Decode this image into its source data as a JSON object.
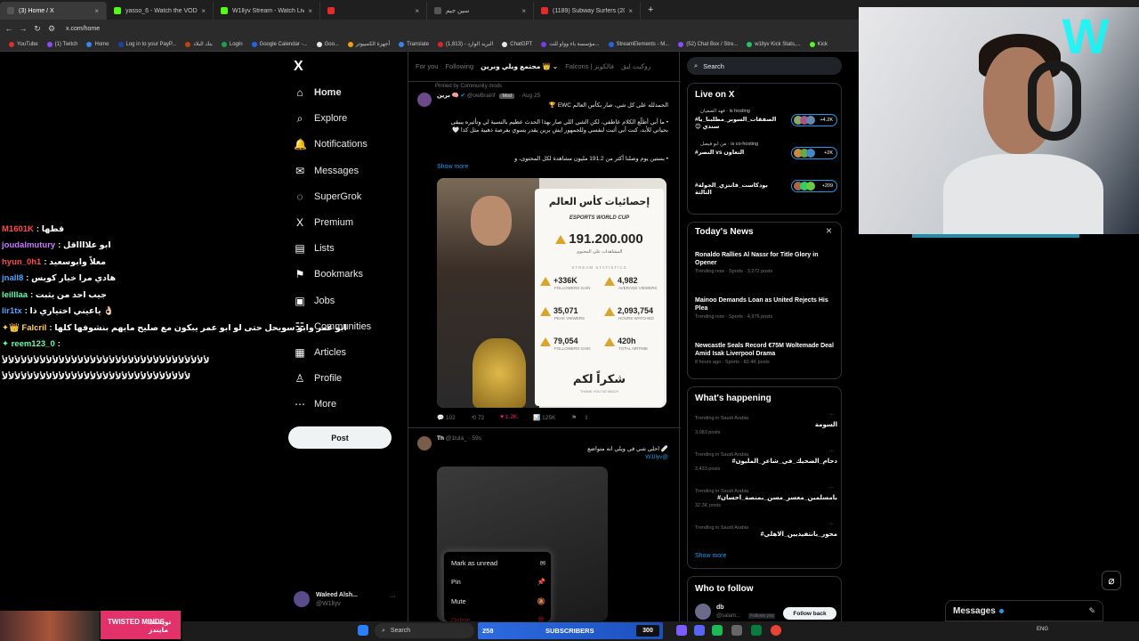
{
  "browser": {
    "tabs": [
      {
        "label": "(3) Home / X",
        "color": "#555555",
        "active": true
      },
      {
        "label": "yasso_6 - Watch the VOD on Kick",
        "color": "#53fc18"
      },
      {
        "label": "W1llyv Stream - Watch Live on",
        "color": "#53fc18"
      },
      {
        "label": "",
        "color": "#e22c2c"
      },
      {
        "label": "سين جيم",
        "color": "#555555"
      },
      {
        "label": "(1189) Subway Surfers (2023)",
        "color": "#e22c2c"
      }
    ],
    "new_tab": "+",
    "url": "x.com/home",
    "bookmarks": [
      {
        "label": "YouTube",
        "color": "#e22c2c"
      },
      {
        "label": "(1) Twitch",
        "color": "#9146ff"
      },
      {
        "label": "Home",
        "color": "#3b82f6"
      },
      {
        "label": "Log in to your PayP...",
        "color": "#1e40af"
      },
      {
        "label": "بنك البلاد",
        "color": "#c2410c"
      },
      {
        "label": "Login",
        "color": "#16a34a"
      },
      {
        "label": "Google Calendar -...",
        "color": "#2563eb"
      },
      {
        "label": "Goo...",
        "color": "#e5e7eb"
      },
      {
        "label": "أجهزة الكمبيوتر",
        "color": "#f59e0b"
      },
      {
        "label": "Translate",
        "color": "#3b82f6"
      },
      {
        "label": "البريد الوارد - (1,813)",
        "color": "#dc2626"
      },
      {
        "label": "ChatGPT",
        "color": "#e5e7eb"
      },
      {
        "label": "مؤسسة باء وواو للت...",
        "color": "#7c3aed"
      },
      {
        "label": "StreamElements - M...",
        "color": "#2563eb"
      },
      {
        "label": "(52) Chat Box / Stre...",
        "color": "#9146ff"
      },
      {
        "label": "w1llyv Kick Stats,...",
        "color": "#22c55e"
      },
      {
        "label": "Kick",
        "color": "#53fc18"
      }
    ]
  },
  "chat": [
    {
      "user": "M1601K",
      "color": "#ff4d4d",
      "msg": ": قطها"
    },
    {
      "user": "joudalmutury",
      "color": "#c678ff",
      "msg": ": ابو علااااقل"
    },
    {
      "user": "hyun_0h1",
      "color": "#ff4d4d",
      "msg": ": معلاً وابوسعيد"
    },
    {
      "user": "jnall8",
      "color": "#4fa3ff",
      "msg": ": هادي مرا خيار كويس"
    },
    {
      "user": "leilllaa",
      "color": "#5cffb0",
      "msg": ": جيب احد من يثبت"
    },
    {
      "user": "lir1tx",
      "color": "#4fa3ff",
      "msg": ": ياعيني اختياري ذا 👌🏻"
    },
    {
      "user": "✦👑 Falcril",
      "color": "#ffd24d",
      "msg": ": ابو عمر وابو سويحل حتى لو ابو عمر يبكون مع صليح مايهم بنشوفها كلها"
    },
    {
      "user": "✦ reem123_0",
      "color": "#5cffb0",
      "msg": ":"
    },
    {
      "user": "",
      "color": "#ffffff",
      "msg": "ﻷﻷﻷﻷﻷﻷﻷﻷﻷﻷﻷﻷﻷﻷﻷﻷﻷﻷﻷﻷﻷﻷﻷﻷﻷﻷﻷﻷﻷﻷﻷﻷﻷ"
    },
    {
      "user": "",
      "color": "#ffffff",
      "msg": "ﻷﻷﻷﻷﻷﻷﻷﻷﻷﻷﻷﻷﻷﻷﻷﻷﻷﻷﻷﻷﻷﻷﻷﻷﻷﻷﻷﻷﻷﻷ"
    }
  ],
  "sidebar": {
    "logo": "X",
    "items": [
      {
        "label": "Home",
        "icon": "⌂",
        "name": "home"
      },
      {
        "label": "Explore",
        "icon": "⌕",
        "name": "explore"
      },
      {
        "label": "Notifications",
        "icon": "🔔",
        "name": "notifications"
      },
      {
        "label": "Messages",
        "icon": "✉",
        "name": "messages"
      },
      {
        "label": "SuperGrok",
        "icon": "◌",
        "name": "supergrok"
      },
      {
        "label": "Premium",
        "icon": "X",
        "name": "premium"
      },
      {
        "label": "Lists",
        "icon": "▤",
        "name": "lists"
      },
      {
        "label": "Bookmarks",
        "icon": "⚑",
        "name": "bookmarks"
      },
      {
        "label": "Jobs",
        "icon": "▣",
        "name": "jobs"
      },
      {
        "label": "Communities",
        "icon": "☷",
        "name": "communities"
      },
      {
        "label": "Articles",
        "icon": "▦",
        "name": "articles"
      },
      {
        "label": "Profile",
        "icon": "♙",
        "name": "profile"
      },
      {
        "label": "More",
        "icon": "⋯",
        "name": "more"
      }
    ],
    "post_label": "Post",
    "account_name": "Waleed Alsh...",
    "account_handle": "@W1llyv",
    "account_more": "···"
  },
  "feed": {
    "tabs": [
      "For you",
      "Following",
      "مجتمع ويلي وبرين 👑 ⌄",
      "Falcons | فالكونز",
      "روكيت ليق"
    ],
    "pinned": "Pinned by Community mods",
    "post1": {
      "name": "برين 🧠",
      "handle": "@owBrainf",
      "badge": "Mod",
      "date": "· Aug 25",
      "text_line1": "الحمدلله على كل شي، صار بكأس العالم EWC 🏆",
      "text_line2": "• ما أبي أطلّع الكلام عاطفي، لكن الشي اللي صار بهذا الحدث عظيم بالنسبة لي وتأثيره يبيقى بحياتي للأبد، كنت أبي أثبت لنفسي وللجمهور ايش برين يقدر يسوي بفرصة ذهبية مثل كذا 🤍",
      "text_line3": "• بستين يوم وصلنا أكثر من 191.2 مليون مشاهدة لكل المحتوى، و",
      "show_more": "Show more",
      "card": {
        "title": "إحصائيات كأس العالم",
        "brand": "ESPORTS WORLD CUP",
        "big_number": "191.200.000",
        "big_caption": "المشاهدات على المحتوى",
        "section": "STREAM STATISTICS",
        "stats": [
          {
            "value": "+336K",
            "label": "FOLLOWERS GAIN"
          },
          {
            "value": "4,982",
            "label": "AVERAGE VIEWERS"
          },
          {
            "value": "35,071",
            "label": "PEAK VIEWERS"
          },
          {
            "value": "2,093,754",
            "label": "HOURS WATCHED"
          },
          {
            "value": "79,054",
            "label": "FOLLOWERS GAIN"
          },
          {
            "value": "420h",
            "label": "TOTAL AIRTIME"
          }
        ],
        "thanks": "شكراً لكم",
        "thanks_sub": "THANK YOU SO MUCH"
      },
      "actions": {
        "reply": "💬 102",
        "repost": "⟲ 72",
        "like": "♥ 1.2K",
        "views": "📊 125K",
        "bookmark": "⚑",
        "share": "⇪"
      }
    },
    "post2": {
      "name": "Th",
      "handle": "@1lula_ · 59s",
      "text": "🩹 احلى شي في ويلي انه متواضع",
      "mention": "@W1llyv"
    }
  },
  "context_menu": {
    "items": [
      {
        "label": "Mark as unread",
        "icon": "✉"
      },
      {
        "label": "Pin",
        "icon": "📌"
      },
      {
        "label": "Mute",
        "icon": "🔕"
      },
      {
        "label": "Delete",
        "icon": "🗑"
      }
    ]
  },
  "right": {
    "search_placeholder": "Search",
    "live": {
      "title": "Live on X",
      "items": [
        {
          "who": "فهد الصفيان · is hosting",
          "title": "الصفقات_السوبر_مطلبنا_يا# سندي 😊",
          "count": "+4.2K"
        },
        {
          "who": "من ابو فيصل · is co-hosting",
          "title": "التعاون vs النصر#",
          "count": "+2K"
        },
        {
          "who": "",
          "title": "بودكاست_فانتزي_الجولة# الثالثة",
          "count": "+209"
        }
      ]
    },
    "news": {
      "title": "Today's News",
      "close": "×",
      "items": [
        {
          "headline": "Ronaldo Rallies Al Nassr for Title Glory in Opener",
          "meta": "Trending now · Sports · 3,272 posts"
        },
        {
          "headline": "Mainoo Demands Loan as United Rejects His Plea",
          "meta": "Trending now · Sports · 4,976 posts"
        },
        {
          "headline": "Newcastle Seals Record €75M Woltemade Deal Amid Isak Liverpool Drama",
          "meta": "8 hours ago · Sports · 82.4K posts"
        }
      ]
    },
    "happening": {
      "title": "What's happening",
      "items": [
        {
          "place": "Trending in Saudi Arabia",
          "name": "السومة",
          "posts": "3,083 posts"
        },
        {
          "place": "Trending in Saudi Arabia",
          "name": "دحام_الضحيك_في_شاعر_المليون#",
          "posts": "2,433 posts"
        },
        {
          "place": "Trending in Saudi Arabia",
          "name": "بامسلمين_معسر_مسن_بمنصة_احسان#",
          "posts": "32.3K posts"
        },
        {
          "place": "Trending in Saudi Arabia",
          "name": "محور_بانتفيذيين_الاهلي#",
          "posts": ""
        }
      ],
      "show_more": "Show more"
    },
    "who_to_follow": {
      "title": "Who to follow",
      "name": "db",
      "handle": "@salam...",
      "follows_you": "Follows you",
      "button": "Follow back"
    }
  },
  "overlay": {
    "messages": "Messages",
    "twisted_left": "TWISTED MINDS",
    "twisted_right": "تويستد مايندز"
  },
  "taskbar": {
    "search": "Search",
    "subs_count": "258",
    "subs_label": "SUBSCRIBERS",
    "goal": "300",
    "lang": "ENG"
  }
}
